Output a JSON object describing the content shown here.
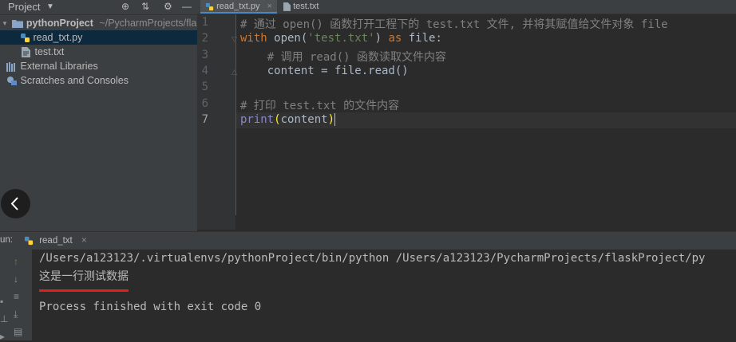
{
  "project_panel": {
    "title": "Project",
    "tree": {
      "root_name": "pythonProject",
      "root_path": "~/PycharmProjects/flas",
      "file1": "read_txt.py",
      "file2": "test.txt",
      "external": "External Libraries",
      "scratches": "Scratches and Consoles"
    }
  },
  "editor_tabs": [
    {
      "label": "read_txt.py"
    },
    {
      "label": "test.txt"
    }
  ],
  "editor": {
    "line_numbers": [
      "1",
      "2",
      "3",
      "4",
      "5",
      "6",
      "7"
    ],
    "line1_comment": "# 通过 open() 函数打开工程下的 test.txt 文件, 并将其赋值给文件对象 file",
    "line2": {
      "kw_with": "with",
      "fn_open": " open(",
      "str": "'test.txt'",
      "rest": ") ",
      "kw_as": "as",
      "tail": " file:"
    },
    "line3_comment": "    # 调用 read() 函数读取文件内容",
    "line4": "    content = file.read()",
    "line6_comment": "# 打印 test.txt 的文件内容",
    "line7": {
      "fn": "print",
      "open_paren": "(",
      "arg": "content",
      "close_paren": ")"
    }
  },
  "run_panel": {
    "prefix": "un:",
    "tab_label": "read_txt",
    "close": "×",
    "output": [
      "/Users/a123123/.virtualenvs/pythonProject/bin/python /Users/a123123/PycharmProjects/flaskProject/py",
      "这是一行测试数据",
      "Process finished with exit code 0"
    ]
  },
  "colors": {
    "accent": "#4a88c7",
    "underline": "#e0201a"
  }
}
